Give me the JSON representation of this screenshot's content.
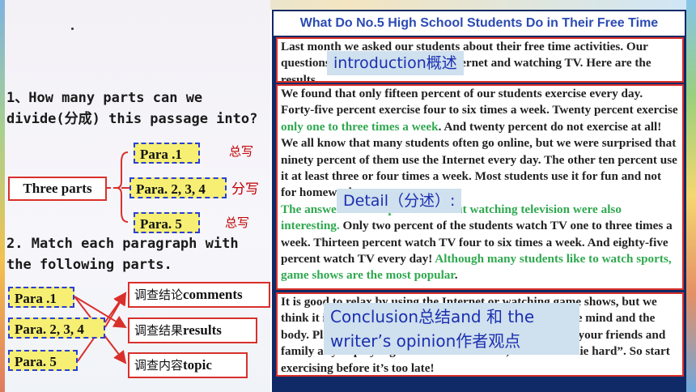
{
  "question1": "1、How many parts can we divide(分成) this passage into?",
  "question2": "2. Match each paragraph with the following parts.",
  "parts": {
    "three_parts": "Three parts",
    "p1": "Para .1",
    "p2": "Para. 2, 3, 4",
    "p3": "Para. 5",
    "p1_label": "总写",
    "p2_label": "分写",
    "p3_label": "总写"
  },
  "match": {
    "left": [
      "Para .1",
      "Para. 2, 3, 4",
      "Para. 5"
    ],
    "right": [
      {
        "cn": "调查结论",
        "en": "comments"
      },
      {
        "cn": "调查结果",
        "en": "results"
      },
      {
        "cn": "调查内容",
        "en": "topic"
      }
    ]
  },
  "article": {
    "title": "What Do No.5 High School Students Do in Their Free Time",
    "para1": "Last month we asked our students about their free time activities. Our questions were about using the Internet and watching TV. Here are the results.",
    "para2a": "We found that only fifteen percent of our students exercise every day. Forty-five percent exercise four to six times a week. Twenty percent exercise ",
    "para2_green": "only one to three times a week",
    "para2b": ". And twenty percent do not exercise at all!",
    "para3": "We all know that many students often go online, but we were surprised that ninety percent of them use the Internet every day. The other ten percent use it at least three or four times a week. Most students use it for fun and not for homework.",
    "para4_green": "The answers to our questions about watching television were also interesting.",
    "para4a": " Only two percent of the students watch TV one to three times a week. Thirteen percent watch TV four to six times a week. And eighty-five percent watch TV every day! ",
    "para4_green2": "Although many students like to watch sports, game shows are the most popular",
    "para4b": ".",
    "para5": "It is good to relax by using the Internet or watching game shows, but we think it is better to exercise every day. It is healthy for the mind and the body. Playing sports is fun, and you can spend time with your friends and family as you play together. And remember, “old habits die hard”. So start exercising before it’s too late!"
  },
  "overlays": {
    "intro": "introduction概述",
    "detail": "Detail（分述）:",
    "conclusion": "Conclusion总结and 和 the writer’s opinion作者观点"
  }
}
